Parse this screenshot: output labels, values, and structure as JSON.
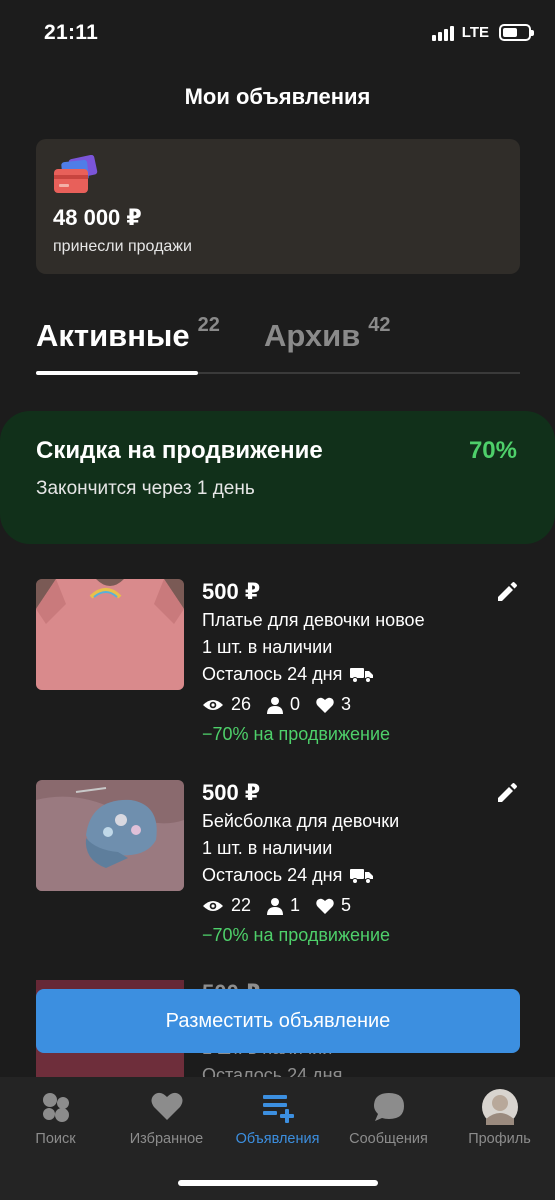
{
  "status": {
    "time": "21:11",
    "network": "LTE",
    "battery_level": 0.6
  },
  "header": {
    "title": "Мои объявления"
  },
  "sales": {
    "amount": "48 000 ₽",
    "caption": "принесли продажи"
  },
  "tabs": [
    {
      "label": "Активные",
      "count": "22"
    },
    {
      "label": "Архив",
      "count": "42"
    }
  ],
  "promo": {
    "title": "Скидка на продвижение",
    "subtitle": "Закончится через 1 день",
    "percent": "70%"
  },
  "listings": [
    {
      "price": "500 ₽",
      "title": "Платье для девочки новое",
      "stock": "1 шт. в наличии",
      "remaining": "Осталось 24 дня",
      "views": "26",
      "contacts": "0",
      "favorites": "3",
      "promo": "−70% на продвижение"
    },
    {
      "price": "500 ₽",
      "title": "Бейсболка для девочки",
      "stock": "1 шт. в наличии",
      "remaining": "Осталось 24 дня",
      "views": "22",
      "contacts": "1",
      "favorites": "5",
      "promo": "−70% на продвижение"
    },
    {
      "price": "500 ₽",
      "stock": "1 шт. в наличии",
      "remaining": "Осталось 24 дня"
    }
  ],
  "post_button": {
    "label": "Разместить объявление"
  },
  "tabbar": [
    {
      "label": "Поиск",
      "icon": "search-bubbles-icon"
    },
    {
      "label": "Избранное",
      "icon": "heart-icon"
    },
    {
      "label": "Объявления",
      "icon": "listings-add-icon"
    },
    {
      "label": "Сообщения",
      "icon": "chat-icon"
    },
    {
      "label": "Профиль",
      "icon": "avatar"
    }
  ],
  "colors": {
    "accent": "#3c8fe0",
    "green": "#4ed06a",
    "background": "#1c1c1c",
    "card": "#302d29",
    "promo_bg": "#11301a"
  }
}
